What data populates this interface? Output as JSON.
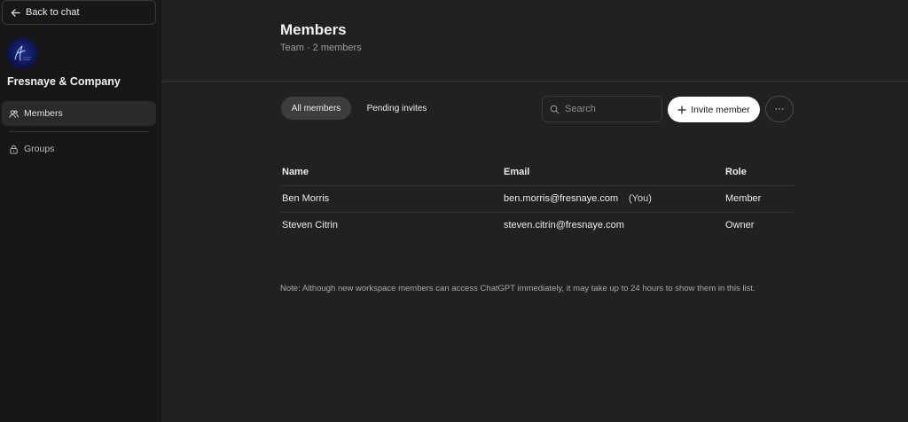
{
  "sidebar": {
    "back_label": "Back to chat",
    "workspace_name": "Fresnaye & Company",
    "items": [
      {
        "label": "Members",
        "icon": "users-icon"
      },
      {
        "label": "Groups",
        "icon": "lock-icon"
      }
    ]
  },
  "header": {
    "title": "Members",
    "subtitle": "Team · 2 members"
  },
  "tabs": [
    {
      "label": "All members",
      "active": true
    },
    {
      "label": "Pending invites",
      "active": false
    }
  ],
  "search": {
    "placeholder": "Search",
    "value": ""
  },
  "toolbar": {
    "invite_label": "Invite member",
    "more_label": "···"
  },
  "table": {
    "columns": [
      "Name",
      "Email",
      "Role"
    ],
    "rows": [
      {
        "name": "Ben Morris",
        "tag": "(You)",
        "email": "ben.morris@fresnaye.com",
        "role": "Member"
      },
      {
        "name": "Steven Citrin",
        "tag": "",
        "email": "steven.citrin@fresnaye.com",
        "role": "Owner"
      }
    ]
  },
  "note": "Note: Although new workspace members can access ChatGPT immediately, it may take up to 24 hours to show them in this list.",
  "colors": {
    "background": "#212121",
    "sidebar": "#171717",
    "accent_button": "#ffffff"
  }
}
